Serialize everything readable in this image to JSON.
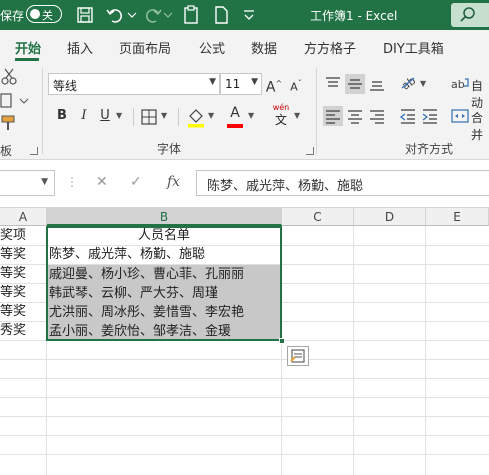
{
  "titlebar": {
    "autosave_label": "保存",
    "toggle_label": "关",
    "doc_title": "工作簿1 - Excel"
  },
  "ribbon_tabs": [
    {
      "label": "开始",
      "active": true
    },
    {
      "label": "插入"
    },
    {
      "label": "页面布局"
    },
    {
      "label": "公式"
    },
    {
      "label": "数据"
    },
    {
      "label": "方方格子"
    },
    {
      "label": "DIY工具箱"
    }
  ],
  "ribbon": {
    "font_name": "等线",
    "font_size": "11",
    "font_group_label": "字体",
    "align_group_label": "对齐方式",
    "wrap_label": "自动",
    "merge_label": "合并",
    "bold": "B",
    "italic": "I",
    "underline": "U",
    "grow_font": "A",
    "shrink_font": "A",
    "wen_label": "wén",
    "wen_char": "文",
    "font_color_letter": "A",
    "accent_color": "#217346",
    "fill_color": "#ffff00",
    "font_color": "#ff0000"
  },
  "formula_bar": {
    "fx_label": "fx",
    "content": "陈梦、戚光萍、杨勤、施聪"
  },
  "sheet": {
    "columns": [
      "A",
      "B",
      "C",
      "D",
      "E"
    ],
    "col_a": [
      "奖项",
      "等奖",
      "等奖",
      "等奖",
      "等奖",
      "秀奖"
    ],
    "col_b": [
      "人员名单",
      "陈梦、戚光萍、杨勤、施聪",
      "戚迎曼、杨小珍、曹心菲、孔丽丽",
      "韩武琴、云柳、严大芬、周瑾",
      "尤洪丽、周冰彤、姜惜雪、李宏艳",
      "孟小丽、姜欣怡、邹孝洁、金瑗"
    ]
  }
}
